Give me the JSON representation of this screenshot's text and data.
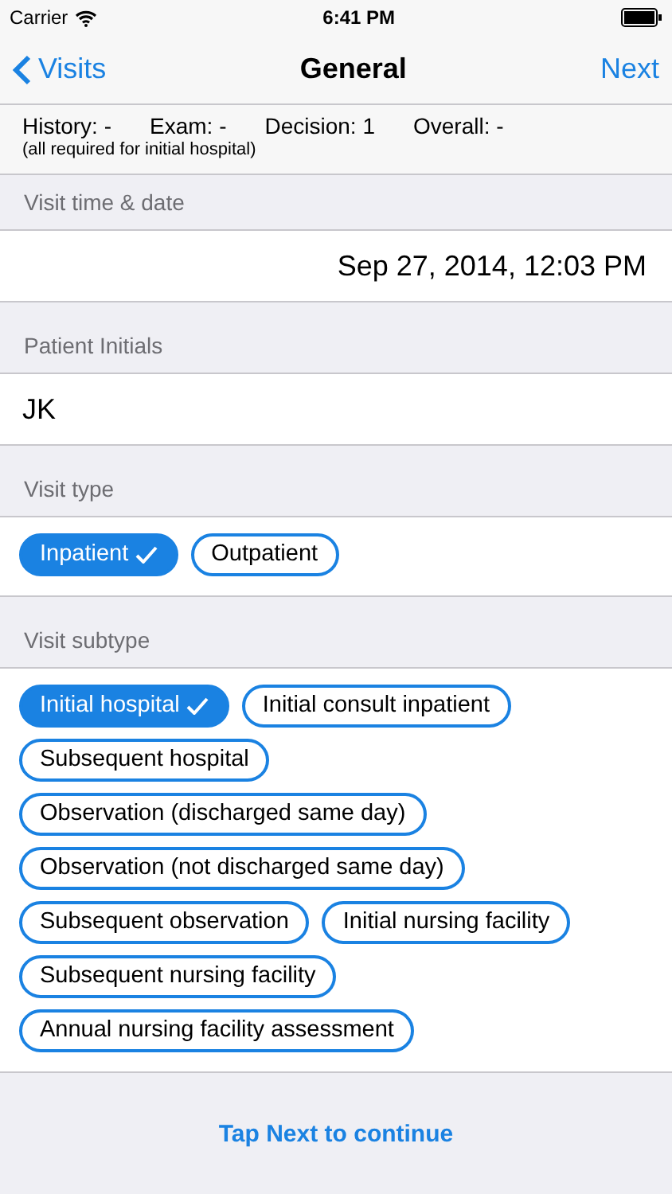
{
  "status_bar": {
    "carrier": "Carrier",
    "time": "6:41 PM"
  },
  "nav": {
    "back": "Visits",
    "title": "General",
    "next": "Next"
  },
  "summary": {
    "items": [
      "History: -",
      "Exam: -",
      "Decision: 1",
      "Overall: -"
    ],
    "note": "(all required for initial hospital)"
  },
  "sections": [
    {
      "header": "Visit time & date",
      "kind": "value",
      "value": "Sep 27, 2014, 12:03 PM"
    },
    {
      "header": "Patient Initials",
      "kind": "input",
      "value": "JK"
    },
    {
      "header": "Visit type",
      "kind": "chips",
      "chips": [
        {
          "label": "Inpatient",
          "selected": true
        },
        {
          "label": "Outpatient",
          "selected": false
        }
      ]
    },
    {
      "header": "Visit subtype",
      "kind": "chips",
      "chips": [
        {
          "label": "Initial hospital",
          "selected": true
        },
        {
          "label": "Initial consult inpatient",
          "selected": false
        },
        {
          "label": "Subsequent hospital",
          "selected": false
        },
        {
          "label": "Observation (discharged same day)",
          "selected": false
        },
        {
          "label": "Observation (not discharged same day)",
          "selected": false
        },
        {
          "label": "Subsequent observation",
          "selected": false
        },
        {
          "label": "Initial nursing facility",
          "selected": false
        },
        {
          "label": "Subsequent nursing facility",
          "selected": false
        },
        {
          "label": "Annual nursing facility assessment",
          "selected": false
        }
      ]
    }
  ],
  "footer": "Tap Next to continue"
}
